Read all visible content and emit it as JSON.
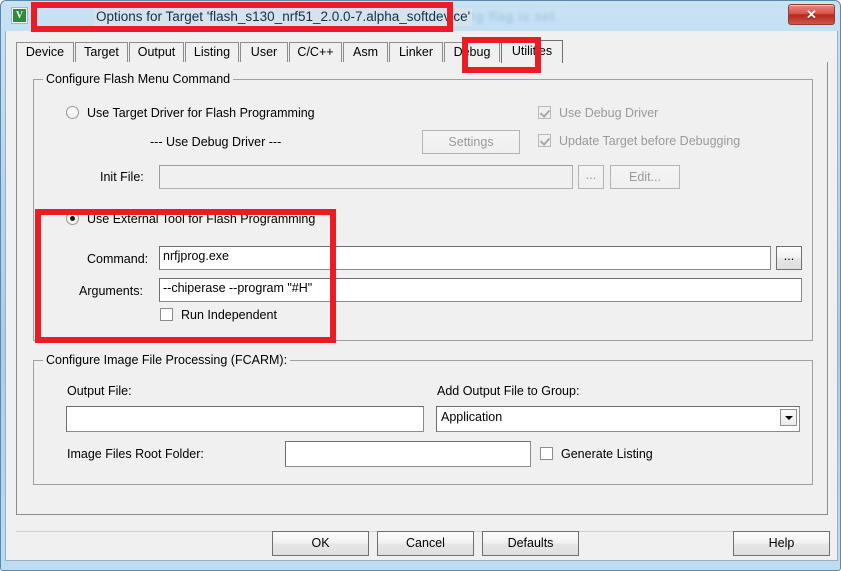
{
  "window": {
    "title": "Options for Target 'flash_s130_nrf51_2.0.0-7.alpha_softdevice'",
    "app_icon_glyph": "V",
    "close_label": "✕",
    "ghost_text": "ding flag is set.",
    "accent_red": "#ec1c24",
    "frame_blue": "#a9cdea"
  },
  "tabs": [
    {
      "label": "Device",
      "selected": false
    },
    {
      "label": "Target",
      "selected": false
    },
    {
      "label": "Output",
      "selected": false
    },
    {
      "label": "Listing",
      "selected": false
    },
    {
      "label": "User",
      "selected": false
    },
    {
      "label": "C/C++",
      "selected": false
    },
    {
      "label": "Asm",
      "selected": false
    },
    {
      "label": "Linker",
      "selected": false
    },
    {
      "label": "Debug",
      "selected": false
    },
    {
      "label": "Utilities",
      "selected": true
    }
  ],
  "flash_menu": {
    "group_title": "Configure Flash Menu Command",
    "target_driver_radio": {
      "label": "Use Target Driver for Flash Programming",
      "checked": false
    },
    "driver_name": "--- Use Debug Driver ---",
    "settings_button": {
      "label": "Settings",
      "enabled": false
    },
    "use_debug_driver_checkbox": {
      "label": "Use Debug Driver",
      "checked": true,
      "enabled": false
    },
    "update_target_checkbox": {
      "label": "Update Target before Debugging",
      "checked": true,
      "enabled": false
    },
    "init_file": {
      "label": "Init File:",
      "value": "",
      "enabled": false
    },
    "init_browse_button": {
      "label": "...",
      "enabled": false
    },
    "edit_button": {
      "label": "Edit...",
      "enabled": false
    },
    "external_tool_radio": {
      "label": "Use External Tool for Flash Programming",
      "checked": true
    },
    "command": {
      "label": "Command:",
      "value": "nrfjprog.exe"
    },
    "command_browse_button": {
      "label": "...",
      "enabled": true
    },
    "arguments": {
      "label": "Arguments:",
      "value": "--chiperase --program \"#H\""
    },
    "run_independent_checkbox": {
      "label": "Run Independent",
      "checked": false
    }
  },
  "image_processing": {
    "group_title": "Configure Image File Processing (FCARM):",
    "output_file": {
      "label": "Output File:",
      "value": ""
    },
    "add_to_group": {
      "label": "Add Output File  to Group:",
      "value": "Application"
    },
    "image_root_folder": {
      "label": "Image Files Root Folder:",
      "value": ""
    },
    "generate_listing_checkbox": {
      "label": "Generate Listing",
      "checked": false
    }
  },
  "footer": {
    "ok": "OK",
    "cancel": "Cancel",
    "defaults": "Defaults",
    "help": "Help"
  }
}
